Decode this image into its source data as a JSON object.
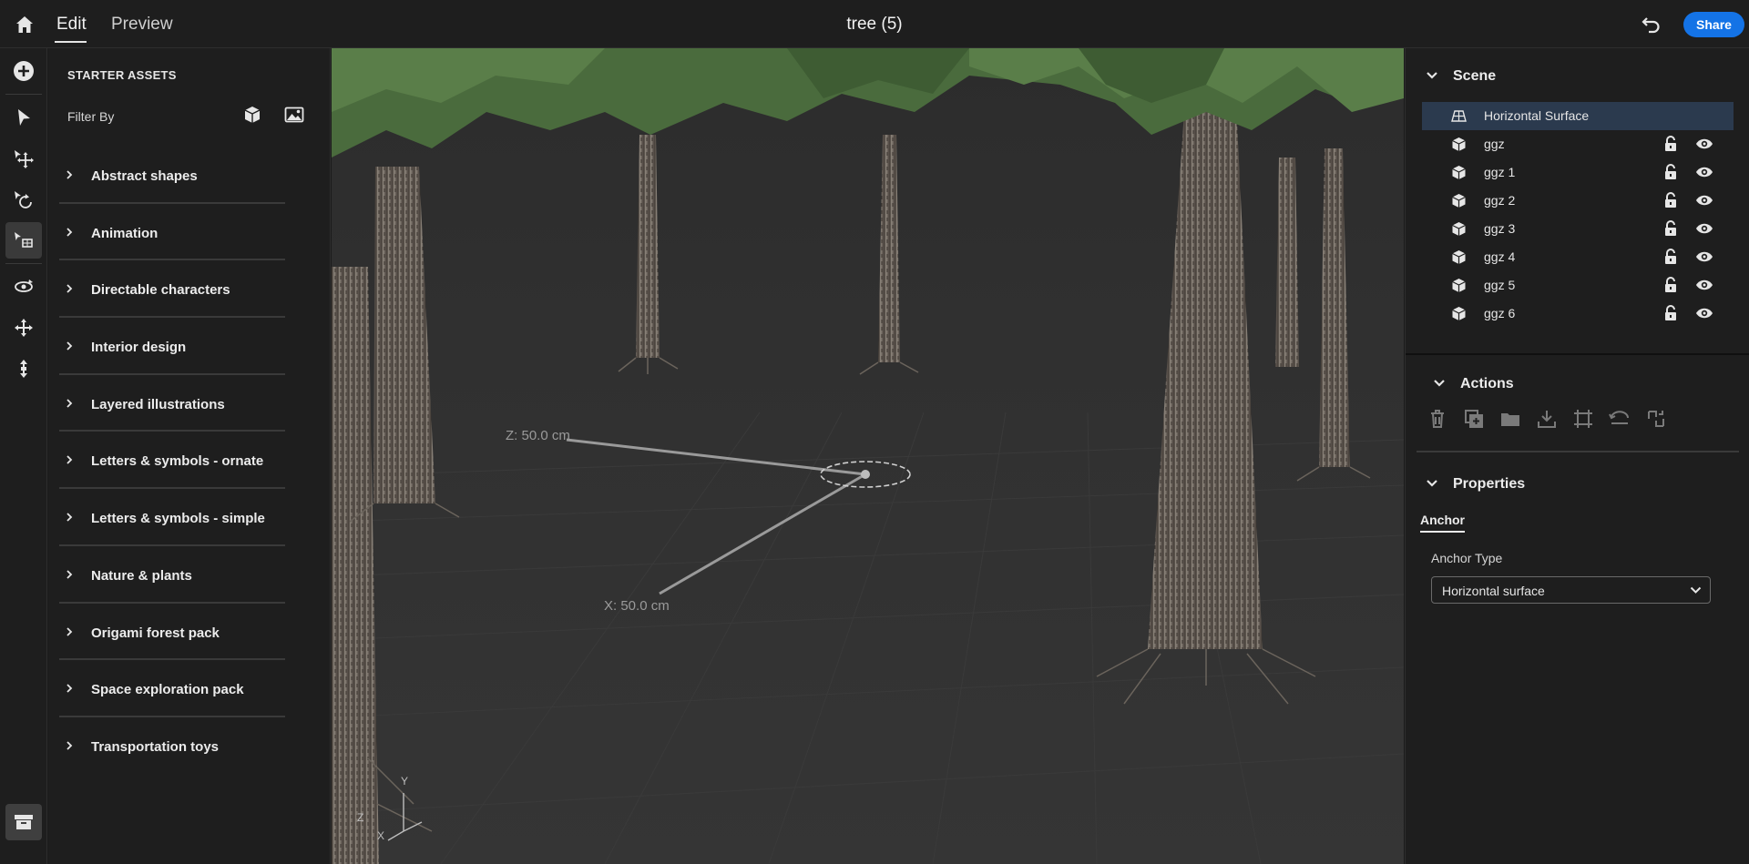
{
  "header": {
    "tabs": [
      {
        "label": "Edit",
        "active": true
      },
      {
        "label": "Preview",
        "active": false
      }
    ],
    "title": "tree (5)",
    "share_label": "Share"
  },
  "toolbar": {
    "tools": [
      "add-icon",
      "select-icon",
      "move-icon",
      "rotate-icon",
      "place-on-surface-icon",
      "orbit-icon",
      "pan-icon",
      "dolly-icon",
      "assets-box-icon"
    ],
    "active_tool": "place-on-surface-icon"
  },
  "assets": {
    "title": "STARTER ASSETS",
    "filter_label": "Filter By",
    "categories": [
      "Abstract shapes",
      "Animation",
      "Directable characters",
      "Interior design",
      "Layered illustrations",
      "Letters & symbols - ornate",
      "Letters & symbols - simple",
      "Nature & plants",
      "Origami forest pack",
      "Space exploration pack",
      "Transportation toys"
    ]
  },
  "viewport": {
    "z_label": "Z:  50.0 cm",
    "x_label": "X:  50.0 cm",
    "axis_y": "Y",
    "axis_z": "Z",
    "axis_x": "X"
  },
  "scene": {
    "title": "Scene",
    "items": [
      {
        "name": "Horizontal Surface",
        "icon": "surface-icon",
        "selected": true
      },
      {
        "name": "ggz",
        "icon": "cube-icon"
      },
      {
        "name": "ggz 1",
        "icon": "cube-icon"
      },
      {
        "name": "ggz 2",
        "icon": "cube-icon"
      },
      {
        "name": "ggz 3",
        "icon": "cube-icon"
      },
      {
        "name": "ggz 4",
        "icon": "cube-icon"
      },
      {
        "name": "ggz 5",
        "icon": "cube-icon"
      },
      {
        "name": "ggz 6",
        "icon": "cube-icon"
      }
    ]
  },
  "actions": {
    "title": "Actions",
    "items": [
      "delete-icon",
      "duplicate-icon",
      "group-icon",
      "download-icon",
      "frame-icon",
      "reset-icon",
      "replace-icon"
    ]
  },
  "properties": {
    "title": "Properties",
    "tab": "Anchor",
    "anchor_type_label": "Anchor Type",
    "anchor_type_value": "Horizontal surface"
  },
  "colors": {
    "accent": "#1473e6",
    "panel_bg": "#1e1e1e",
    "viewport_bg": "#313131",
    "selection_bg": "#2b3a4e"
  }
}
